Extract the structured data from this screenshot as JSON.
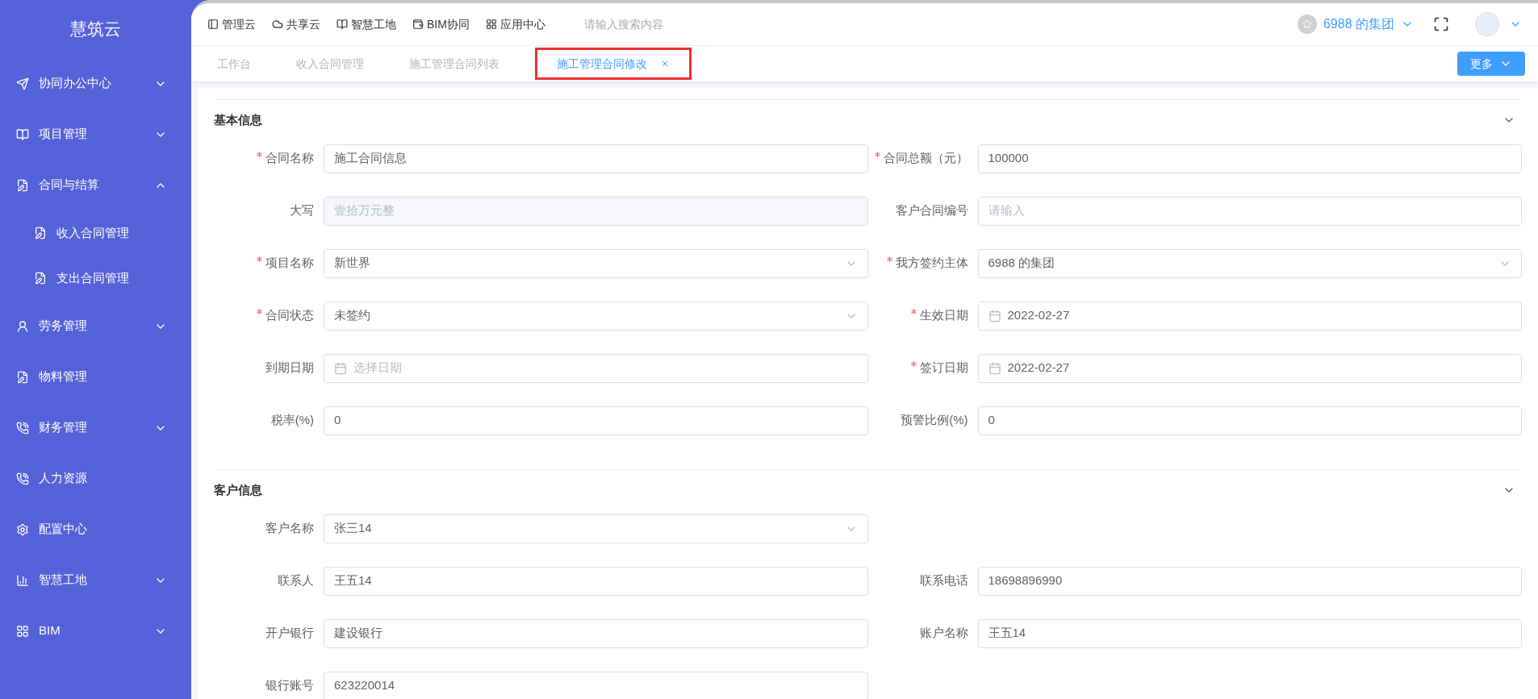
{
  "sidebar": {
    "title": "慧筑云",
    "items": [
      {
        "label": "协同办公中心",
        "expanded": false
      },
      {
        "label": "项目管理",
        "expanded": false
      },
      {
        "label": "合同与结算",
        "expanded": true,
        "children": [
          {
            "label": "收入合同管理"
          },
          {
            "label": "支出合同管理"
          }
        ]
      },
      {
        "label": "劳务管理",
        "expanded": false
      },
      {
        "label": "物料管理"
      },
      {
        "label": "财务管理",
        "expanded": false
      },
      {
        "label": "人力资源"
      },
      {
        "label": "配置中心"
      },
      {
        "label": "智慧工地",
        "expanded": false
      },
      {
        "label": "BIM",
        "expanded": false
      }
    ]
  },
  "top_nav": {
    "links": [
      {
        "label": "管理云"
      },
      {
        "label": "共享云"
      },
      {
        "label": "智慧工地"
      },
      {
        "label": "BIM协同"
      },
      {
        "label": "应用中心"
      }
    ],
    "search": {
      "placeholder": "请输入搜索内容"
    },
    "organization": "6988 的集团"
  },
  "tabs": [
    {
      "label": "工作台",
      "selected": false
    },
    {
      "label": "收入合同管理",
      "selected": false
    },
    {
      "label": "施工管理合同列表",
      "selected": false
    },
    {
      "label": "施工管理合同修改",
      "selected": true
    }
  ],
  "more_button": "更多",
  "sections": [
    {
      "title": "基本信息",
      "expanded": true,
      "rows": [
        [
          {
            "label": "合同名称",
            "required": true,
            "kind": "text",
            "value": "施工合同信息"
          },
          {
            "label": "合同总额（元）",
            "required": true,
            "kind": "text",
            "value": "100000"
          }
        ],
        [
          {
            "label": "大写",
            "required": false,
            "kind": "disabled",
            "placeholder": "壹拾万元整"
          },
          {
            "label": "客户合同编号",
            "required": false,
            "kind": "text",
            "placeholder": "请输入"
          }
        ],
        [
          {
            "label": "项目名称",
            "required": true,
            "kind": "select",
            "value": "新世界"
          },
          {
            "label": "我方签约主体",
            "required": true,
            "kind": "select",
            "value": "6988 的集团"
          }
        ],
        [
          {
            "label": "合同状态",
            "required": true,
            "kind": "select",
            "value": "未签约"
          },
          {
            "label": "生效日期",
            "required": true,
            "kind": "date",
            "value": "2022-02-27"
          }
        ],
        [
          {
            "label": "到期日期",
            "required": false,
            "kind": "date",
            "placeholder": "选择日期"
          },
          {
            "label": "签订日期",
            "required": true,
            "kind": "date",
            "value": "2022-02-27"
          }
        ],
        [
          {
            "label": "税率(%)",
            "required": false,
            "kind": "text",
            "value": "0"
          },
          {
            "label": "预警比例(%)",
            "required": false,
            "kind": "text",
            "value": "0"
          }
        ]
      ]
    },
    {
      "title": "客户信息",
      "expanded": true,
      "rows": [
        [
          {
            "label": "客户名称",
            "required": false,
            "kind": "select",
            "value": "张三14"
          }
        ],
        [
          {
            "label": "联系人",
            "required": false,
            "kind": "text",
            "value": "王五14"
          },
          {
            "label": "联系电话",
            "required": false,
            "kind": "text",
            "value": "18698896990"
          }
        ],
        [
          {
            "label": "开户银行",
            "required": false,
            "kind": "text",
            "value": "建设银行"
          },
          {
            "label": "账户名称",
            "required": false,
            "kind": "text",
            "value": "王五14"
          }
        ],
        [
          {
            "label": "银行账号",
            "required": false,
            "kind": "text",
            "value": "623220014"
          }
        ]
      ]
    }
  ]
}
